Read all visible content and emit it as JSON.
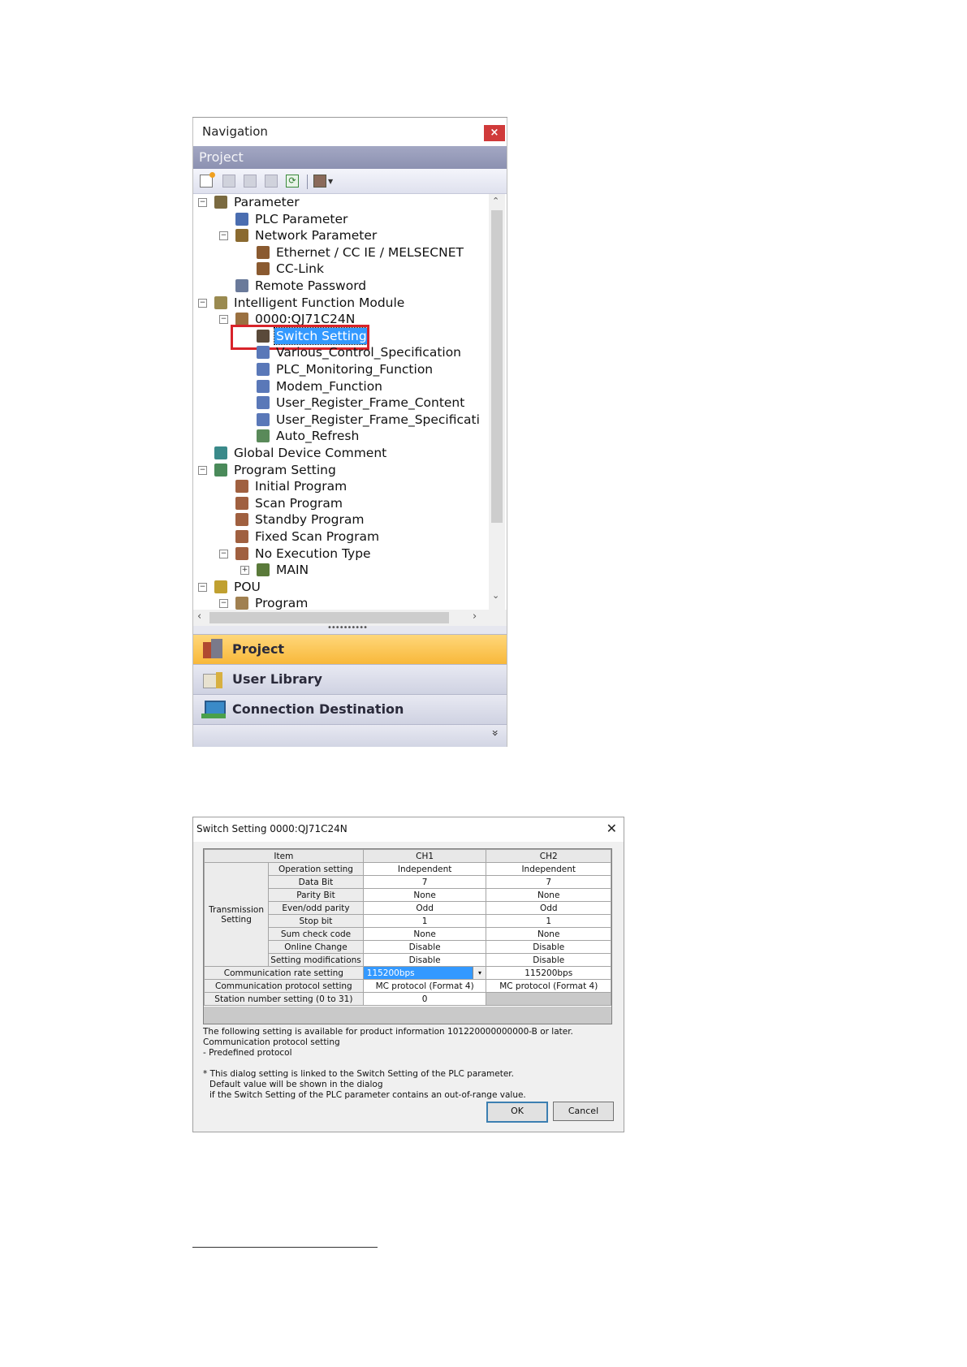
{
  "navigation": {
    "title": "Navigation",
    "close": "×",
    "section_header": "Project",
    "tree": [
      {
        "label": "Parameter",
        "level": 0,
        "expander": "−",
        "icon": "parameter-icon",
        "color": "#7a6a40"
      },
      {
        "label": "PLC Parameter",
        "level": 1,
        "icon": "plc-parameter-icon",
        "color": "#4a6db0"
      },
      {
        "label": "Network Parameter",
        "level": 1,
        "expander": "−",
        "icon": "network-parameter-icon",
        "color": "#8a6a30"
      },
      {
        "label": "Ethernet / CC IE / MELSECNET",
        "level": 2,
        "icon": "ethernet-icon",
        "color": "#8a5a30"
      },
      {
        "label": "CC-Link",
        "level": 2,
        "icon": "cc-link-icon",
        "color": "#8a5a30"
      },
      {
        "label": "Remote Password",
        "level": 1,
        "icon": "remote-password-icon",
        "color": "#6a7a9a"
      },
      {
        "label": "Intelligent Function Module",
        "level": 0,
        "expander": "−",
        "icon": "intelligent-module-icon",
        "color": "#9a8a50"
      },
      {
        "label": "0000:QJ71C24N",
        "level": 1,
        "expander": "−",
        "icon": "module-icon",
        "color": "#9a7040"
      },
      {
        "label": "Switch Setting",
        "level": 2,
        "icon": "switch-setting-icon",
        "color": "#5a4a3a",
        "selected": true
      },
      {
        "label": "Various_Control_Specification",
        "level": 2,
        "icon": "setting-icon",
        "color": "#5a78b8"
      },
      {
        "label": "PLC_Monitoring_Function",
        "level": 2,
        "icon": "setting-icon",
        "color": "#5a78b8"
      },
      {
        "label": "Modem_Function",
        "level": 2,
        "icon": "setting-icon",
        "color": "#5a78b8"
      },
      {
        "label": "User_Register_Frame_Content",
        "level": 2,
        "icon": "setting-icon",
        "color": "#5a78b8"
      },
      {
        "label": "User_Register_Frame_Specificati",
        "level": 2,
        "icon": "setting-icon",
        "color": "#5a78b8"
      },
      {
        "label": "Auto_Refresh",
        "level": 2,
        "icon": "auto-refresh-icon",
        "color": "#5a8a5a"
      },
      {
        "label": "Global Device Comment",
        "level": 0,
        "icon": "global-comment-icon",
        "color": "#3a8a8a"
      },
      {
        "label": "Program Setting",
        "level": 0,
        "expander": "−",
        "icon": "program-setting-icon",
        "color": "#4a8a5a"
      },
      {
        "label": "Initial Program",
        "level": 1,
        "icon": "program-icon",
        "color": "#a06040"
      },
      {
        "label": "Scan Program",
        "level": 1,
        "icon": "program-icon",
        "color": "#a06040"
      },
      {
        "label": "Standby Program",
        "level": 1,
        "icon": "program-icon",
        "color": "#a06040"
      },
      {
        "label": "Fixed Scan Program",
        "level": 1,
        "icon": "program-icon",
        "color": "#a06040"
      },
      {
        "label": "No Execution Type",
        "level": 1,
        "expander": "−",
        "icon": "program-icon",
        "color": "#a06040"
      },
      {
        "label": "MAIN",
        "level": 2,
        "expander": "+",
        "icon": "main-program-icon",
        "color": "#5a7a3a"
      },
      {
        "label": "POU",
        "level": 0,
        "expander": "−",
        "icon": "pou-icon",
        "color": "#c0a030"
      },
      {
        "label": "Program",
        "level": 1,
        "expander": "−",
        "icon": "program-folder-icon",
        "color": "#a08050"
      }
    ],
    "buttons": [
      {
        "label": "Project",
        "icon": "project-icon",
        "active": true
      },
      {
        "label": "User Library",
        "icon": "user-library-icon",
        "active": false
      },
      {
        "label": "Connection Destination",
        "icon": "connection-destination-icon",
        "active": false
      }
    ],
    "footer_chevron": "»"
  },
  "dialog": {
    "title": "Switch Setting 0000:QJ71C24N",
    "close": "✕",
    "columns": [
      "Item",
      "CH1",
      "CH2"
    ],
    "group_label_line1": "Transmission",
    "group_label_line2": "Setting",
    "transmission_rows": [
      {
        "item": "Operation setting",
        "ch1": "Independent",
        "ch2": "Independent"
      },
      {
        "item": "Data Bit",
        "ch1": "7",
        "ch2": "7"
      },
      {
        "item": "Parity Bit",
        "ch1": "None",
        "ch2": "None"
      },
      {
        "item": "Even/odd parity",
        "ch1": "Odd",
        "ch2": "Odd"
      },
      {
        "item": "Stop bit",
        "ch1": "1",
        "ch2": "1"
      },
      {
        "item": "Sum check code",
        "ch1": "None",
        "ch2": "None"
      },
      {
        "item": "Online Change",
        "ch1": "Disable",
        "ch2": "Disable"
      },
      {
        "item": "Setting modifications",
        "ch1": "Disable",
        "ch2": "Disable"
      }
    ],
    "comm_rate": {
      "item": "Communication rate setting",
      "ch1": "115200bps",
      "ch2": "115200bps"
    },
    "comm_protocol": {
      "item": "Communication protocol setting",
      "ch1": "MC protocol (Format 4)",
      "ch2": "MC protocol (Format 4)"
    },
    "station": {
      "item": "Station number setting (0 to 31)",
      "ch1": "0"
    },
    "notes": [
      "The following setting is available for product information 101220000000000-B or later.",
      "Communication protocol setting",
      "- Predefined protocol",
      "* This dialog setting is linked to the Switch Setting of the PLC parameter.",
      "Default value will be shown in the dialog",
      "if the Switch Setting of the PLC parameter contains an out-of-range value."
    ],
    "ok_label": "OK",
    "cancel_label": "Cancel"
  }
}
